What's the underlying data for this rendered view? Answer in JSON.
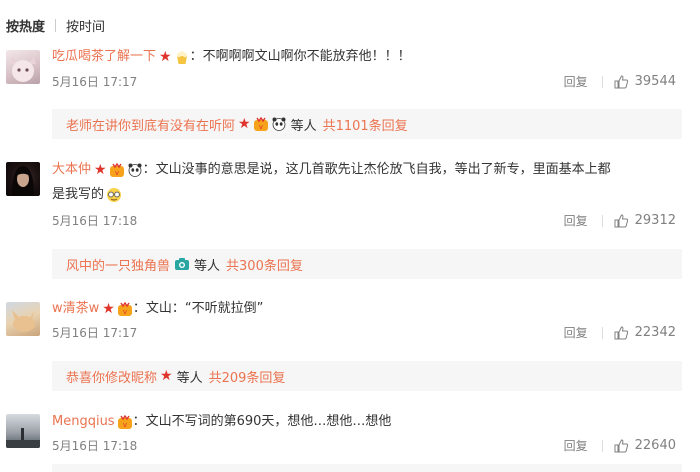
{
  "sort": {
    "hot": "按热度",
    "time": "按时间"
  },
  "comments": [
    {
      "username": "吃瓜喝茶了解一下",
      "text": "不啊啊啊文山啊你不能放弃他！！！",
      "time": "5月16日 17:17",
      "reply_label": "回复",
      "likes": "39544",
      "replies": {
        "name": "老师在讲你到底有没有在听阿",
        "etc": "等人",
        "total": "共1101条回复"
      }
    },
    {
      "username": "大本仲",
      "text": "文山没事的意思是说，这几首歌先让杰伦放飞自我，等出了新专，里面基本上都",
      "text2": "是我写的",
      "time": "5月16日 17:18",
      "reply_label": "回复",
      "likes": "29312",
      "replies": {
        "name": "风中的一只独角兽",
        "etc": "等人",
        "total": "共300条回复"
      }
    },
    {
      "username": "w清茶w",
      "text": "文山：“不听就拉倒”",
      "time": "5月16日 17:17",
      "reply_label": "回复",
      "likes": "22342",
      "replies": {
        "name": "恭喜你修改昵称",
        "etc": "等人",
        "total": "共209条回复"
      }
    },
    {
      "username": "Mengqius",
      "text": "文山不写词的第690天，想他…想他…想他",
      "time": "5月16日 17:18",
      "reply_label": "回复",
      "likes": "22640"
    }
  ],
  "icons": {
    "star": "star-badge-icon",
    "vip": "vip-crown-icon",
    "like": "thumbs-up-icon"
  },
  "colors": {
    "username": "#eb7350",
    "star": "#e0332b",
    "meta": "#808080",
    "reply_bg": "#f6f6f6"
  }
}
